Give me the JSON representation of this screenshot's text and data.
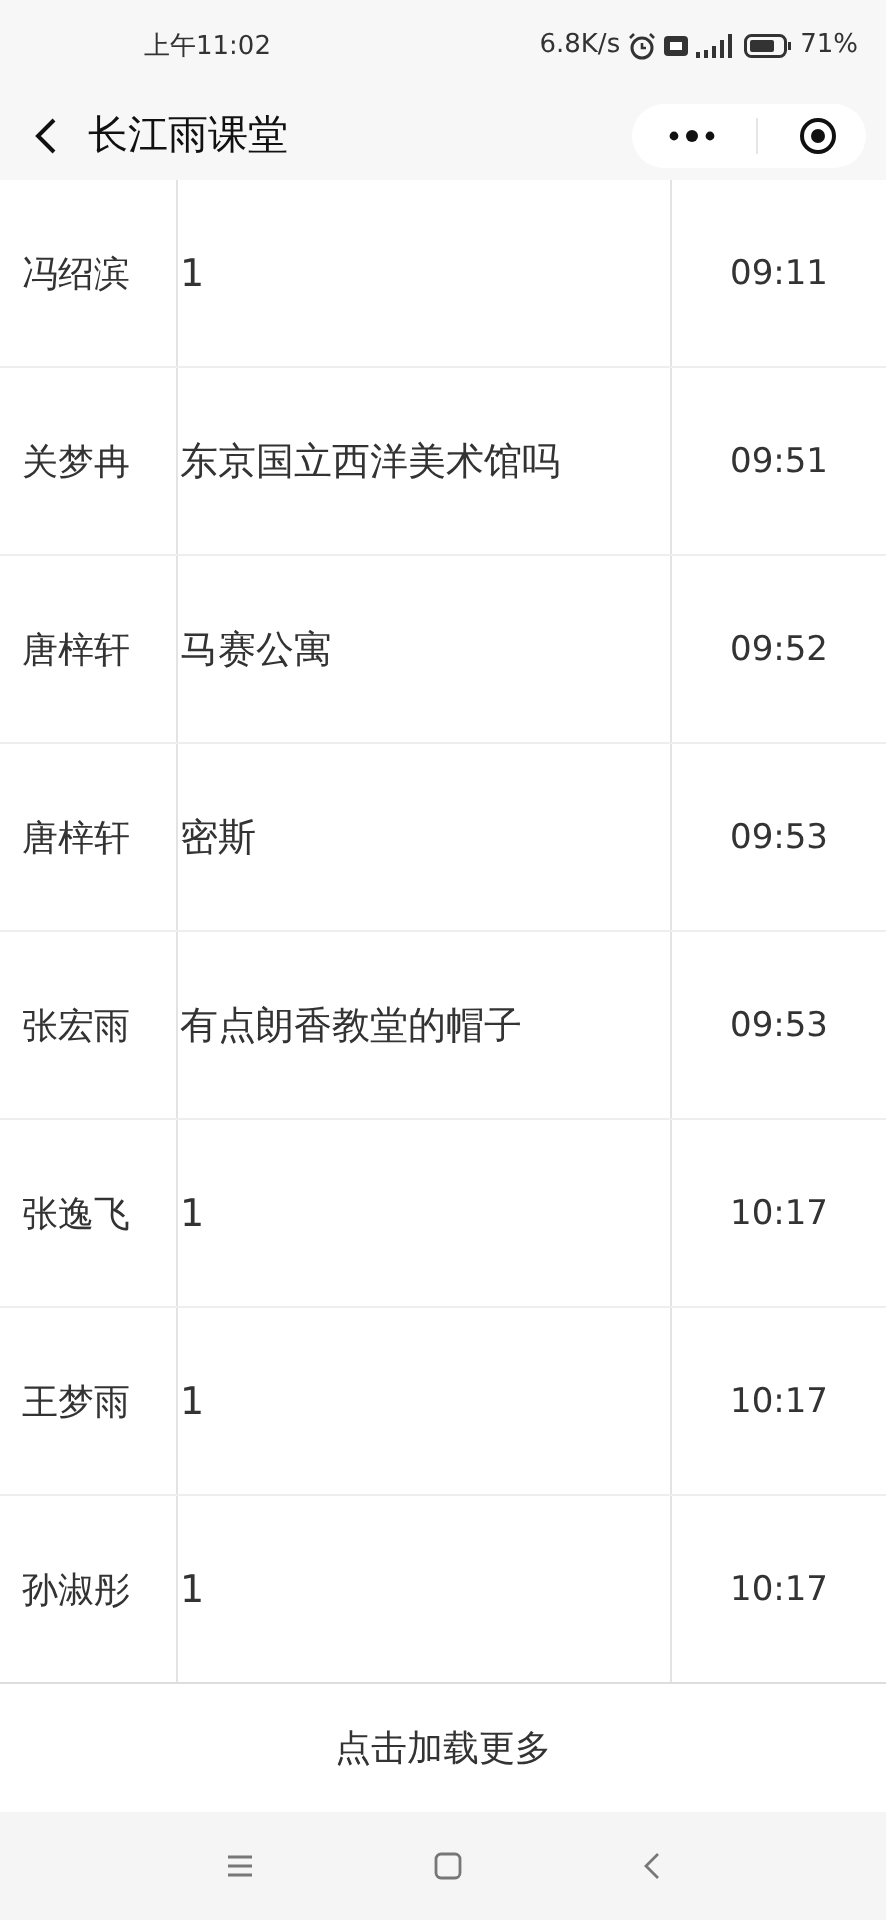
{
  "status_bar": {
    "time": "上午11:02",
    "speed": "6.8K/s",
    "battery": "71%"
  },
  "header": {
    "title": "长江雨课堂"
  },
  "rows": [
    {
      "name": "冯绍滨",
      "message": "1",
      "time": "09:11"
    },
    {
      "name": "关梦冉",
      "message": "东京国立西洋美术馆吗",
      "time": "09:51"
    },
    {
      "name": "唐梓轩",
      "message": "马赛公寓",
      "time": "09:52"
    },
    {
      "name": "唐梓轩",
      "message": "密斯",
      "time": "09:53"
    },
    {
      "name": "张宏雨",
      "message": "有点朗香教堂的帽子",
      "time": "09:53"
    },
    {
      "name": "张逸飞",
      "message": "1",
      "time": "10:17"
    },
    {
      "name": "王梦雨",
      "message": "1",
      "time": "10:17"
    },
    {
      "name": "孙淑彤",
      "message": "1",
      "time": "10:17"
    }
  ],
  "load_more": "点击加载更多"
}
